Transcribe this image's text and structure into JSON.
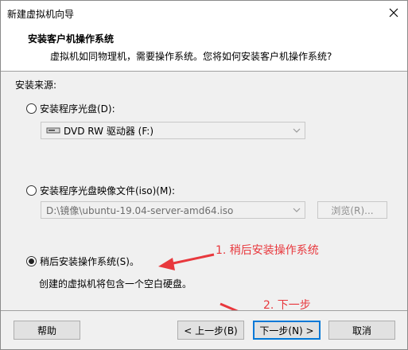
{
  "window": {
    "title": "新建虚拟机向导"
  },
  "header": {
    "title": "安装客户机操作系统",
    "subtitle": "虚拟机如同物理机，需要操作系统。您将如何安装客户机操作系统?"
  },
  "source": {
    "label": "安装来源:",
    "option_disc": {
      "label": "安装程序光盘(D):",
      "selected": false,
      "drive_value": "DVD RW 驱动器 (F:)"
    },
    "option_iso": {
      "label": "安装程序光盘映像文件(iso)(M):",
      "selected": false,
      "path_value": "D:\\镜像\\ubuntu-19.04-server-amd64.iso",
      "browse_label": "浏览(R)..."
    },
    "option_later": {
      "label": "稍后安装操作系统(S)。",
      "selected": true,
      "description": "创建的虚拟机将包含一个空白硬盘。"
    }
  },
  "annotations": {
    "step1": "1. 稍后安装操作系统",
    "step2": "2. 下一步",
    "color": "#e8383d"
  },
  "footer": {
    "help": "帮助",
    "back": "< 上一步(B)",
    "next": "下一步(N) >",
    "cancel": "取消"
  },
  "colors": {
    "panel": "#f0f0f0",
    "accent": "#0078d7",
    "annotation": "#e8383d"
  }
}
